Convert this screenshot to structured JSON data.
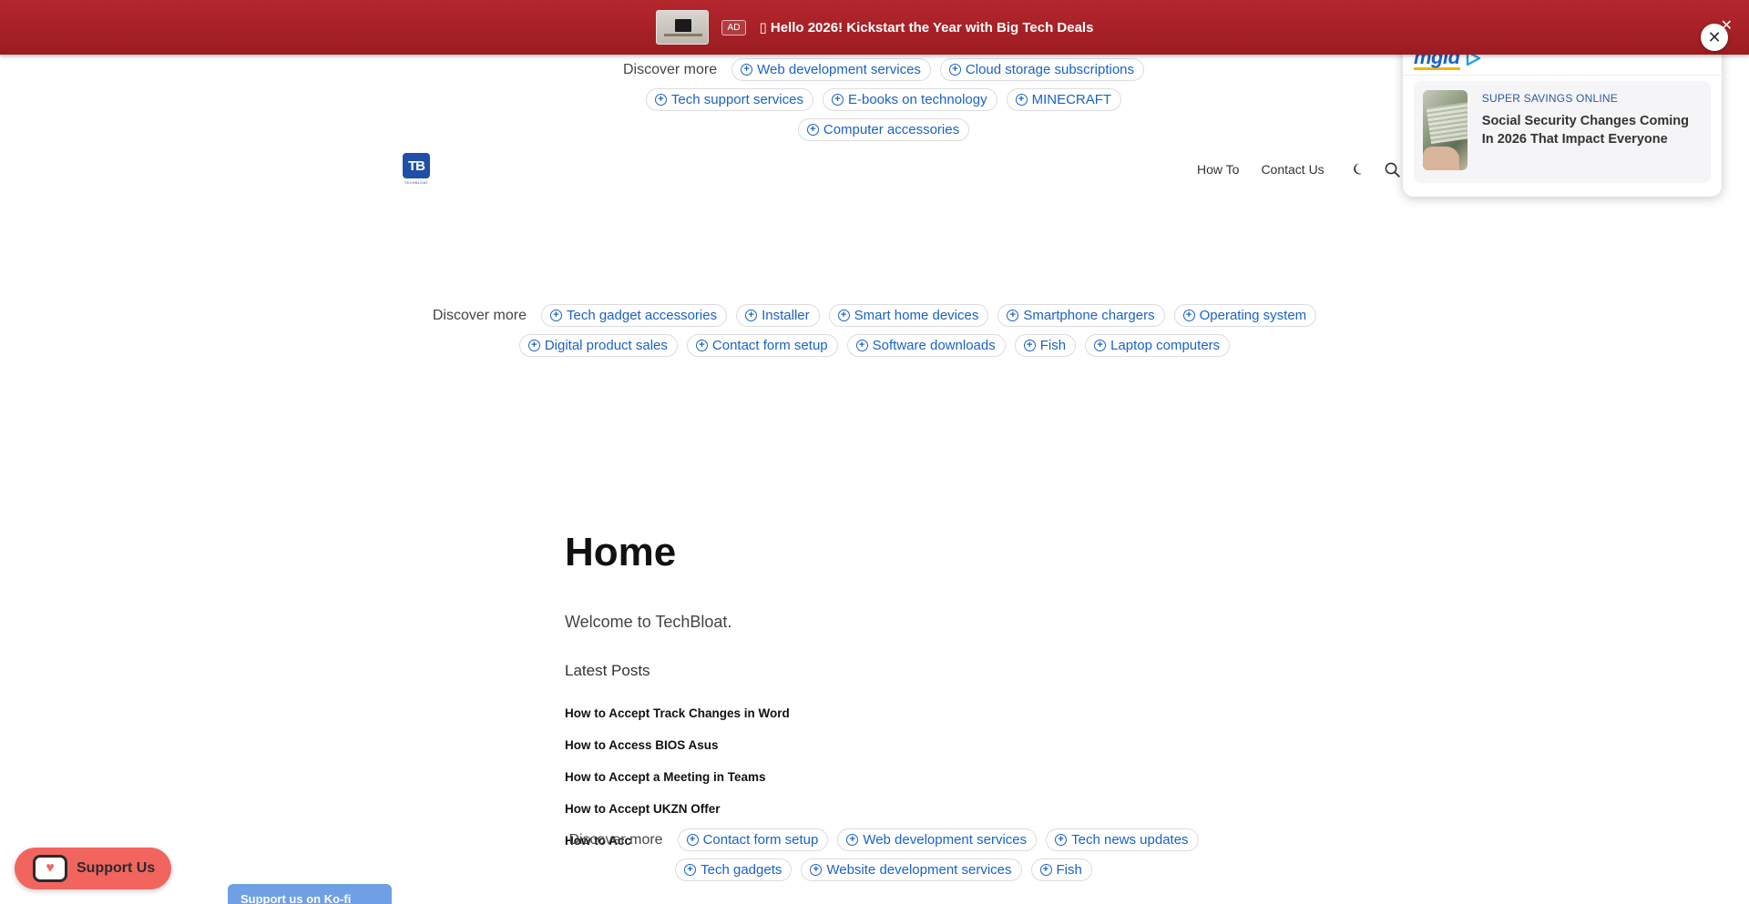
{
  "top_ad": {
    "badge": "AD",
    "text": "▯ Hello 2026! Kickstart the Year with Big Tech Deals",
    "close": "✕"
  },
  "discover_top": {
    "label": "Discover more",
    "chips": [
      "Web development services",
      "Cloud storage subscriptions",
      "Tech support services",
      "E-books on technology",
      "MINECRAFT",
      "Computer accessories"
    ]
  },
  "header": {
    "logo_text": "TB",
    "logo_caption": "TECHBLOAT",
    "nav": [
      "How To",
      "Contact Us"
    ]
  },
  "mgid_widget": {
    "brand": "mgid",
    "kicker": "SUPER SAVINGS ONLINE",
    "headline": "Social Security Changes Coming In 2026 That Impact Everyone",
    "close": "✕"
  },
  "discover_mid": {
    "label": "Discover more",
    "chips": [
      "Tech gadget accessories",
      "Installer",
      "Smart home devices",
      "Smartphone chargers",
      "Operating system",
      "Digital product sales",
      "Contact form setup",
      "Software downloads",
      "Fish",
      "Laptop computers"
    ]
  },
  "main": {
    "title": "Home",
    "welcome": "Welcome to TechBloat.",
    "latest_label": "Latest Posts",
    "posts": [
      "How to Accept Track Changes in Word",
      "How to Access BIOS Asus",
      "How to Accept a Meeting in Teams",
      "How to Accept UKZN Offer",
      "How to Acc"
    ]
  },
  "discover_bottom": {
    "label": "Discover more",
    "chips": [
      "Contact form setup",
      "Web development services",
      "Tech news updates",
      "Tech gadgets",
      "Website development services",
      "Fish"
    ]
  },
  "support": {
    "label": "Support Us",
    "kofi_label": "Support us on Ko-fi"
  }
}
